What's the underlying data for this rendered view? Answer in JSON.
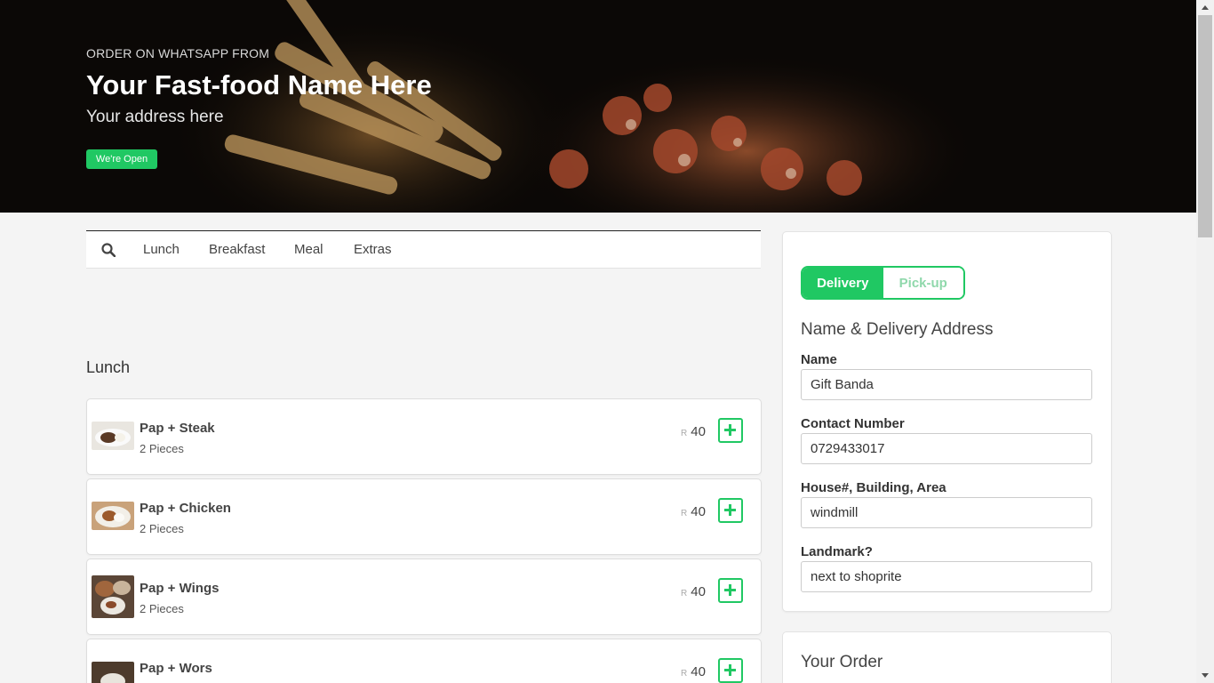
{
  "hero": {
    "subtitle": "ORDER ON WHATSAPP FROM",
    "title": "Your Fast-food Name Here",
    "address": "Your address here",
    "status_badge": "We're Open"
  },
  "categories": {
    "tabs": [
      "Lunch",
      "Breakfast",
      "Meal",
      "Extras"
    ]
  },
  "menu": {
    "section_title": "Lunch",
    "currency": "R",
    "items": [
      {
        "name": "Pap + Steak",
        "desc": "2 Pieces",
        "price": "40"
      },
      {
        "name": "Pap + Chicken",
        "desc": "2 Pieces",
        "price": "40"
      },
      {
        "name": "Pap + Wings",
        "desc": "2 Pieces",
        "price": "40"
      },
      {
        "name": "Pap + Wors",
        "desc": "",
        "price": "40"
      }
    ]
  },
  "checkout": {
    "mode_delivery": "Delivery",
    "mode_pickup": "Pick-up",
    "heading": "Name & Delivery Address",
    "fields": {
      "name_label": "Name",
      "name_value": "Gift Banda",
      "contact_label": "Contact Number",
      "contact_value": "0729433017",
      "address_label": "House#, Building, Area",
      "address_value": "windmill",
      "landmark_label": "Landmark?",
      "landmark_value": "next to shoprite"
    },
    "order_heading": "Your Order"
  },
  "colors": {
    "accent": "#20c863",
    "hero_bg": "#0b0806"
  },
  "icons": {
    "search": "search-icon",
    "add": "plus-square-icon"
  }
}
